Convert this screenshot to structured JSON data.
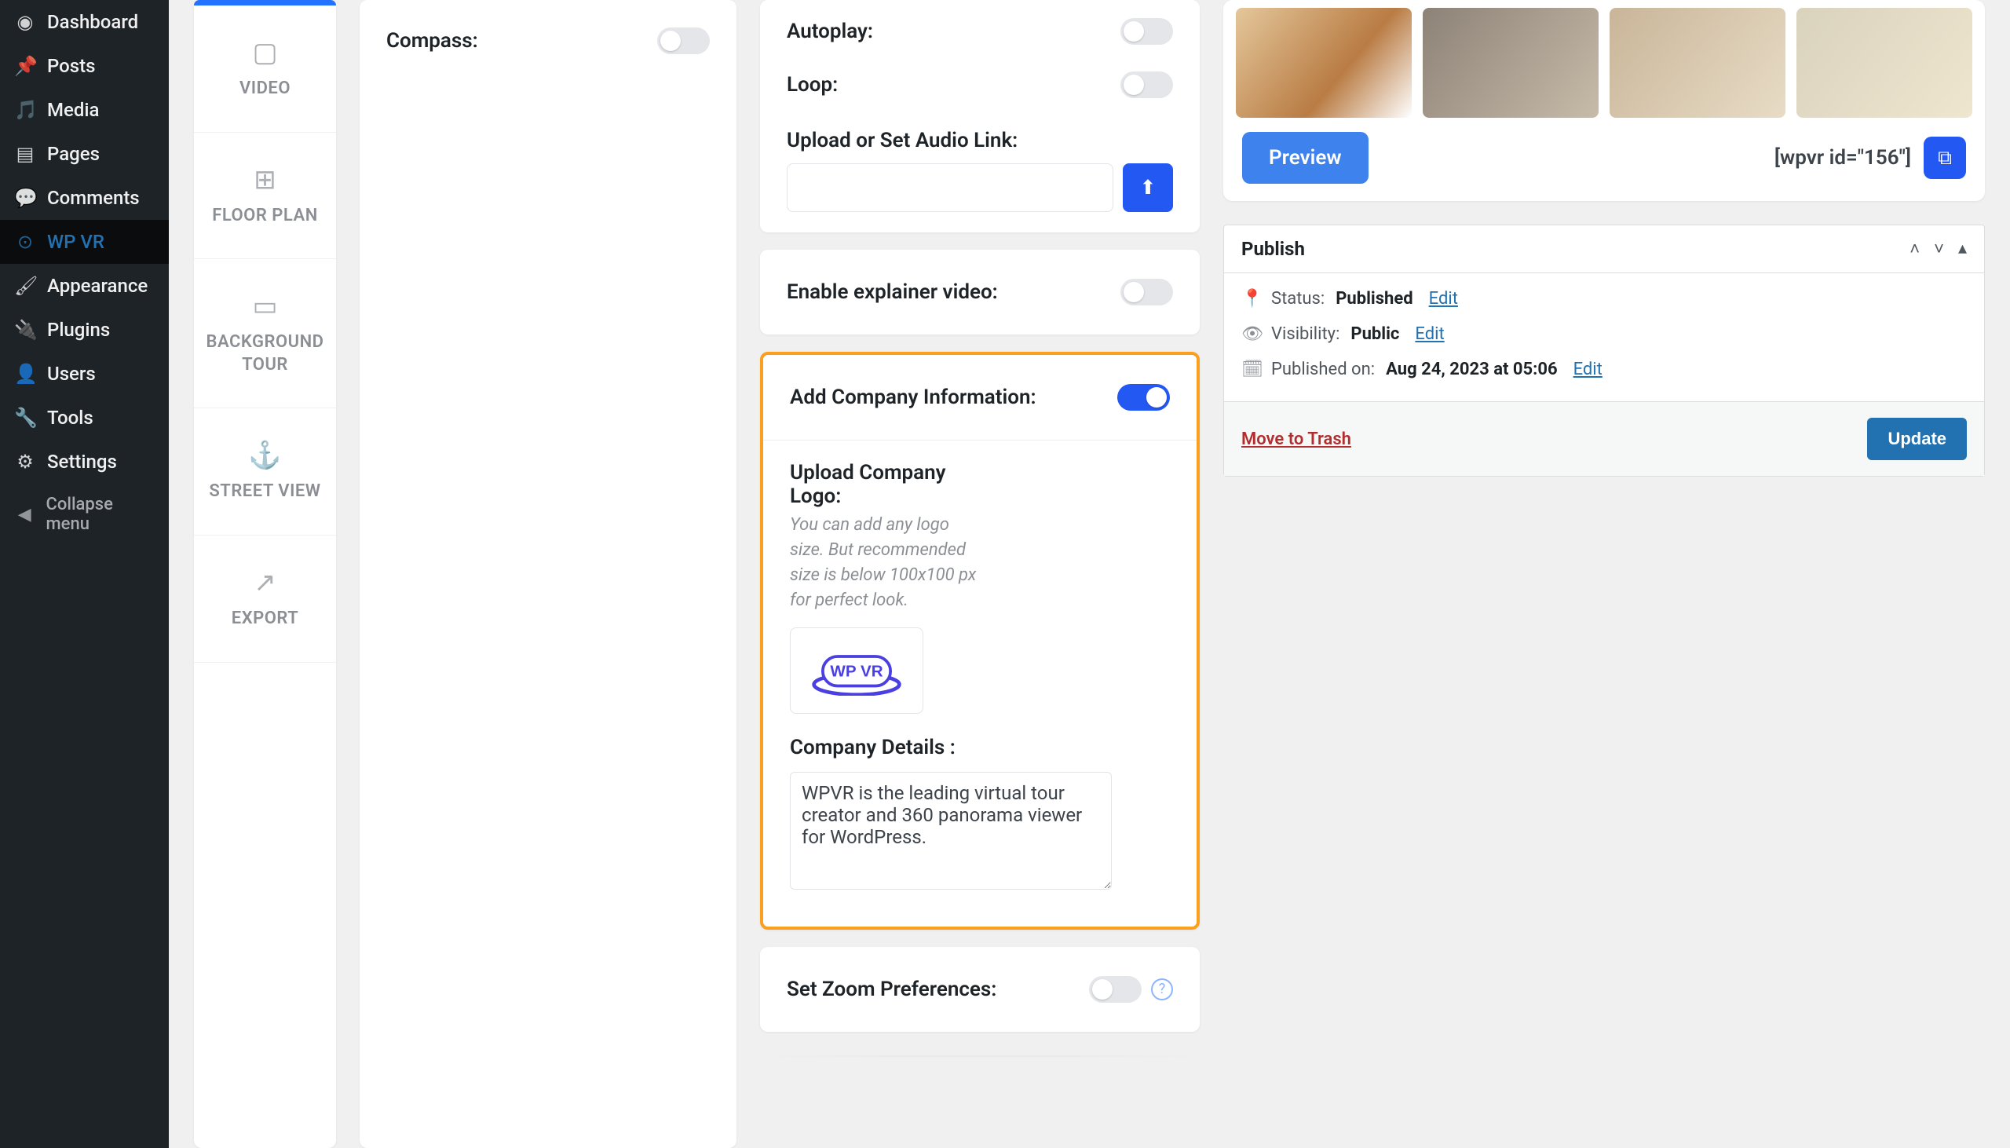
{
  "admin_menu": {
    "dashboard": "Dashboard",
    "posts": "Posts",
    "media": "Media",
    "pages": "Pages",
    "comments": "Comments",
    "wpvr": "WP VR",
    "appearance": "Appearance",
    "plugins": "Plugins",
    "users": "Users",
    "tools": "Tools",
    "settings": "Settings",
    "collapse": "Collapse menu"
  },
  "tabs": {
    "video": "VIDEO",
    "floorplan": "FLOOR PLAN",
    "bgtour": "BACKGROUND TOUR",
    "streetview": "STREET VIEW",
    "export": "EXPORT"
  },
  "left": {
    "compass": "Compass:"
  },
  "audio": {
    "autoplay": "Autoplay:",
    "loop": "Loop:",
    "upload_label": "Upload or Set Audio Link:"
  },
  "explainer": {
    "label": "Enable explainer video:"
  },
  "company": {
    "heading": "Add Company Information:",
    "upload_logo_label": "Upload Company Logo:",
    "hint": "You can add any logo size. But recommended size is below 100x100 px for perfect look.",
    "logo_text": "WP VR",
    "details_label": "Company Details :",
    "details_value": "WPVR is the leading virtual tour creator and 360 panorama viewer for WordPress."
  },
  "zoom": {
    "label": "Set Zoom Preferences:"
  },
  "gallery": {
    "preview": "Preview",
    "shortcode": "[wpvr id=\"156\"]"
  },
  "publish": {
    "title": "Publish",
    "status_label": "Status:",
    "status_value": "Published",
    "edit": "Edit",
    "visibility_label": "Visibility:",
    "visibility_value": "Public",
    "published_on_label": "Published on:",
    "published_on_value": "Aug 24, 2023 at 05:06",
    "trash": "Move to Trash",
    "update": "Update"
  }
}
